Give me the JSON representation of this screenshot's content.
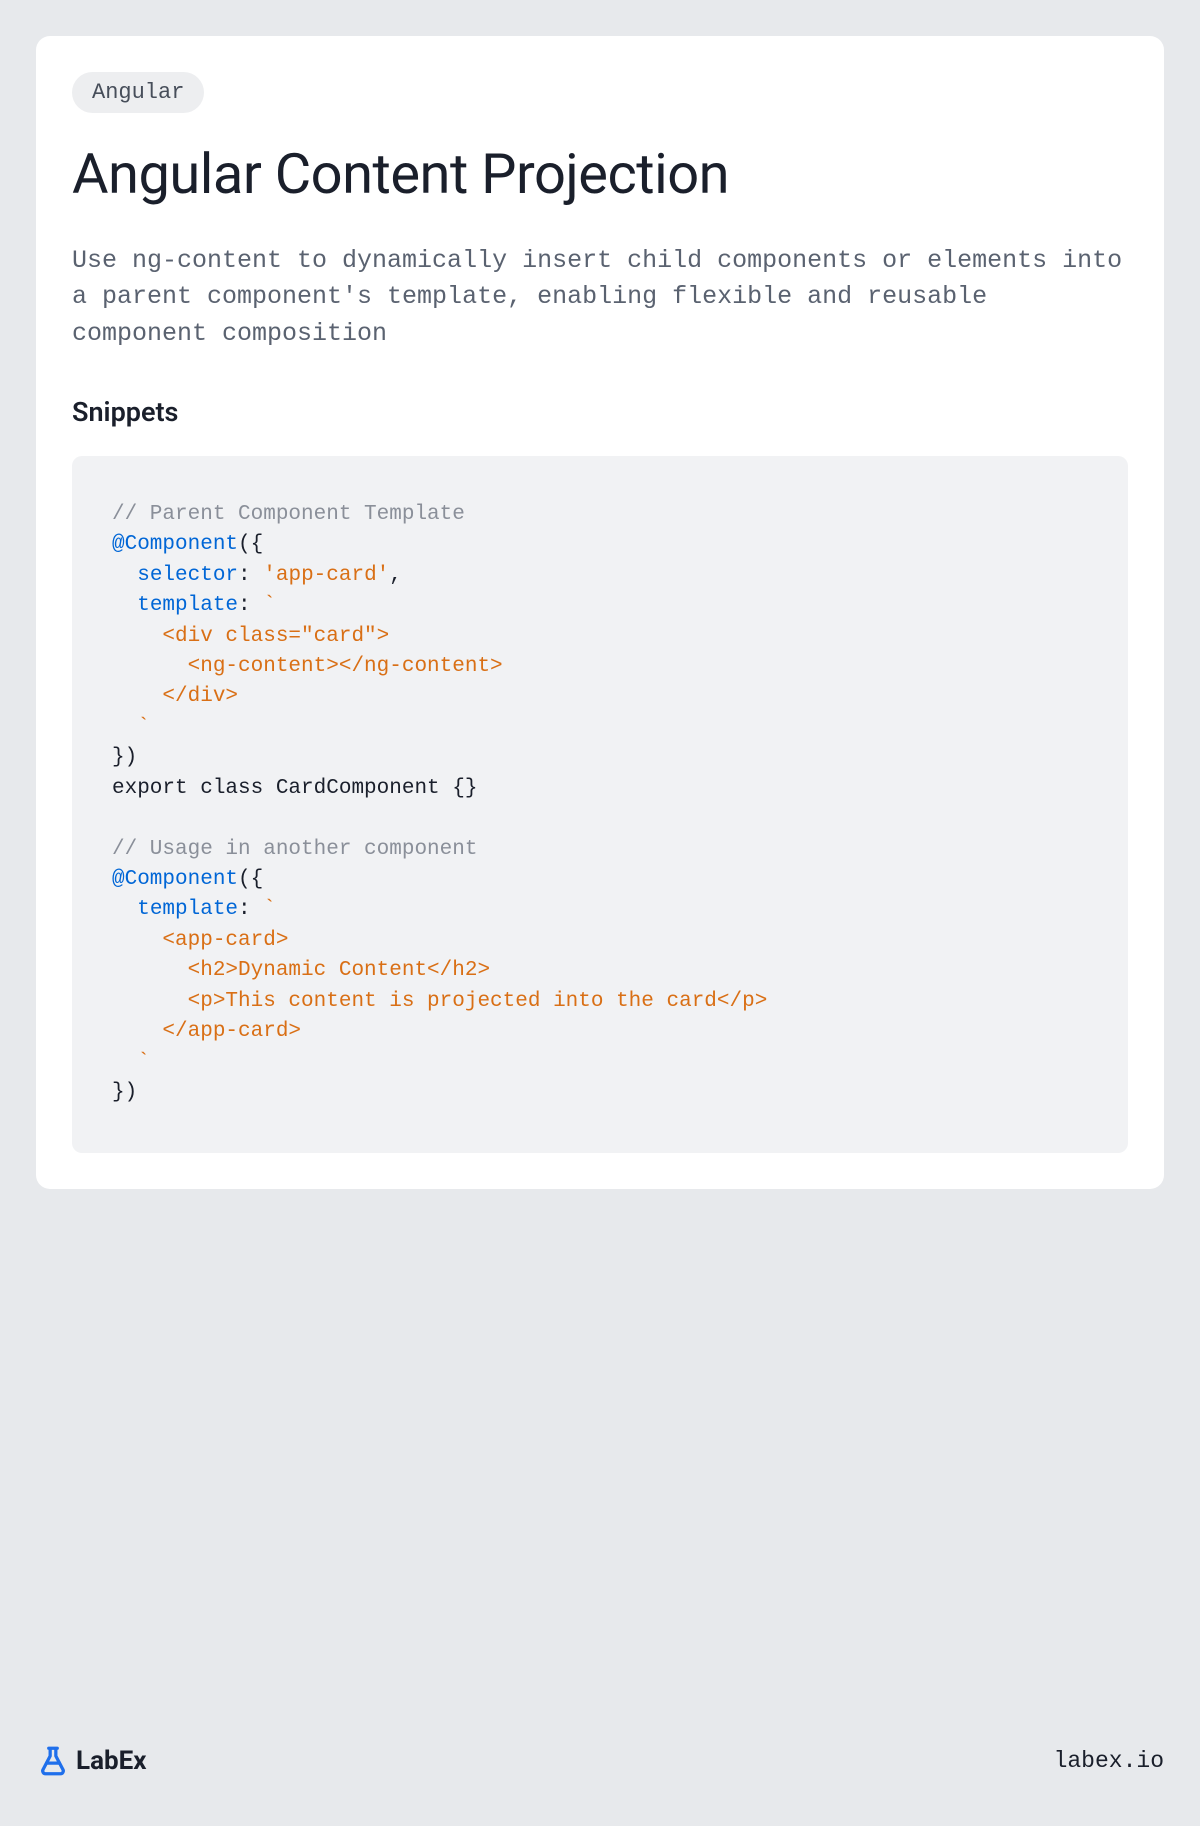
{
  "badge": "Angular",
  "title": "Angular Content Projection",
  "description": "Use ng-content to dynamically insert child components or elements into a parent component's template, enabling flexible and reusable component composition",
  "section_title": "Snippets",
  "code": {
    "l1": "// Parent Component Template",
    "l2a": "@Component",
    "l2b": "({",
    "l3a": "  ",
    "l3b": "selector",
    "l3c": ": ",
    "l3d": "'app-card'",
    "l3e": ",",
    "l4a": "  ",
    "l4b": "template",
    "l4c": ": ",
    "l4d": "`",
    "l5": "    <div class=\"card\">",
    "l6": "      <ng-content></ng-content>",
    "l7": "    </div>",
    "l8": "  `",
    "l9": "})",
    "l10": "export class CardComponent {}",
    "l12": "// Usage in another component",
    "l13a": "@Component",
    "l13b": "({",
    "l14a": "  ",
    "l14b": "template",
    "l14c": ": ",
    "l14d": "`",
    "l15": "    <app-card>",
    "l16": "      <h2>Dynamic Content</h2>",
    "l17": "      <p>This content is projected into the card</p>",
    "l18": "    </app-card>",
    "l19": "  `",
    "l20": "})"
  },
  "footer": {
    "brand": "LabEx",
    "site": "labex.io"
  }
}
